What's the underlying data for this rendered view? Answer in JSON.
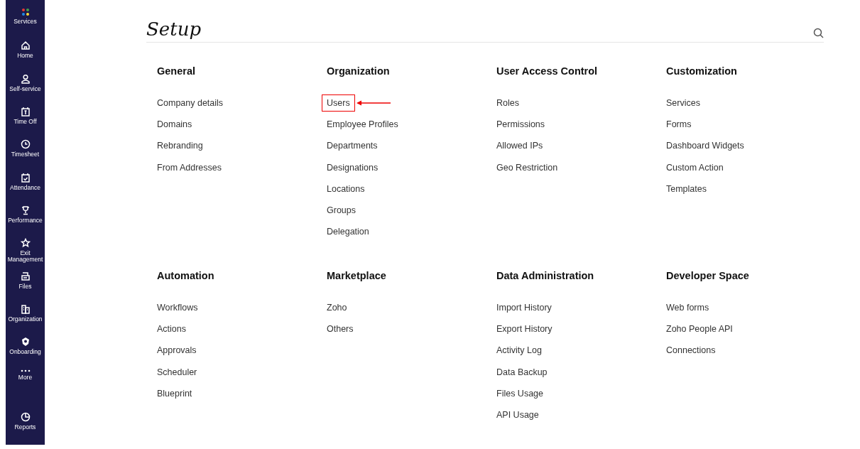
{
  "sidebar": {
    "items": [
      {
        "label": "Services",
        "kind": "dots"
      },
      {
        "label": "Home",
        "kind": "home"
      },
      {
        "label": "Self-service",
        "kind": "person"
      },
      {
        "label": "Time Off",
        "kind": "calendar"
      },
      {
        "label": "Timesheet",
        "kind": "clock"
      },
      {
        "label": "Attendance",
        "kind": "calendar-check"
      },
      {
        "label": "Performance",
        "kind": "trophy"
      },
      {
        "label": "Exit Management",
        "kind": "star"
      },
      {
        "label": "Files",
        "kind": "files"
      },
      {
        "label": "Organization",
        "kind": "building"
      },
      {
        "label": "Onboarding",
        "kind": "badge"
      },
      {
        "label": "More",
        "kind": "more"
      },
      {
        "label": "Reports",
        "kind": "chart"
      }
    ]
  },
  "page": {
    "title": "Setup"
  },
  "sections": [
    {
      "heading": "General",
      "links": [
        {
          "label": "Company details",
          "highlighted": false
        },
        {
          "label": "Domains",
          "highlighted": false
        },
        {
          "label": "Rebranding",
          "highlighted": false
        },
        {
          "label": "From Addresses",
          "highlighted": false
        }
      ]
    },
    {
      "heading": "Organization",
      "links": [
        {
          "label": "Users",
          "highlighted": true
        },
        {
          "label": "Employee Profiles",
          "highlighted": false
        },
        {
          "label": "Departments",
          "highlighted": false
        },
        {
          "label": "Designations",
          "highlighted": false
        },
        {
          "label": "Locations",
          "highlighted": false
        },
        {
          "label": "Groups",
          "highlighted": false
        },
        {
          "label": "Delegation",
          "highlighted": false
        }
      ]
    },
    {
      "heading": "User Access Control",
      "links": [
        {
          "label": "Roles",
          "highlighted": false
        },
        {
          "label": "Permissions",
          "highlighted": false
        },
        {
          "label": "Allowed IPs",
          "highlighted": false
        },
        {
          "label": "Geo Restriction",
          "highlighted": false
        }
      ]
    },
    {
      "heading": "Customization",
      "links": [
        {
          "label": "Services",
          "highlighted": false
        },
        {
          "label": "Forms",
          "highlighted": false
        },
        {
          "label": "Dashboard Widgets",
          "highlighted": false
        },
        {
          "label": "Custom Action",
          "highlighted": false
        },
        {
          "label": "Templates",
          "highlighted": false
        }
      ]
    },
    {
      "heading": "Automation",
      "links": [
        {
          "label": "Workflows",
          "highlighted": false
        },
        {
          "label": "Actions",
          "highlighted": false
        },
        {
          "label": "Approvals",
          "highlighted": false
        },
        {
          "label": "Scheduler",
          "highlighted": false
        },
        {
          "label": "Blueprint",
          "highlighted": false
        }
      ]
    },
    {
      "heading": "Marketplace",
      "links": [
        {
          "label": "Zoho",
          "highlighted": false
        },
        {
          "label": "Others",
          "highlighted": false
        }
      ]
    },
    {
      "heading": "Data Administration",
      "links": [
        {
          "label": "Import History",
          "highlighted": false
        },
        {
          "label": "Export History",
          "highlighted": false
        },
        {
          "label": "Activity Log",
          "highlighted": false
        },
        {
          "label": "Data Backup",
          "highlighted": false
        },
        {
          "label": "Files Usage",
          "highlighted": false
        },
        {
          "label": "API Usage",
          "highlighted": false
        }
      ]
    },
    {
      "heading": "Developer Space",
      "links": [
        {
          "label": "Web forms",
          "highlighted": false
        },
        {
          "label": "Zoho People API",
          "highlighted": false
        },
        {
          "label": "Connections",
          "highlighted": false
        }
      ]
    }
  ]
}
